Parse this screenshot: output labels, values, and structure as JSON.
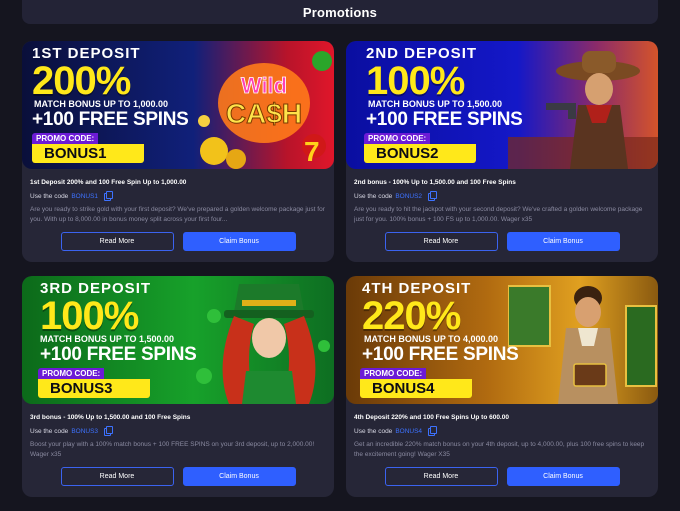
{
  "page": {
    "title": "Promotions"
  },
  "colors": {
    "accent_blue": "#2f5fff",
    "promo_yellow": "#ffe81a",
    "promo_purple": "#6c1bd6",
    "card_bg": "#262637",
    "page_bg": "#15151f"
  },
  "cards": [
    {
      "banner": {
        "title": "1ST DEPOSIT",
        "percent": "200%",
        "match": "MATCH BONUS UP TO 1,000.00",
        "spins": "+100 FREE SPINS",
        "promo_label": "PROMO CODE:",
        "promo_code": "BONUS1",
        "art": "wild-cash-slot-logo"
      },
      "headline": "1st Deposit 200% and 100 Free Spin Up to 1,000.00",
      "use_code_label": "Use the code",
      "code": "BONUS1",
      "description": "Are you ready to strike gold with your first deposit? We've prepared a golden welcome package just for you. With up to 8,000.00 in bonus money split across your first four...",
      "read_more": "Read More",
      "claim": "Claim Bonus"
    },
    {
      "banner": {
        "title": "2ND DEPOSIT",
        "percent": "100%",
        "match": "MATCH BONUS UP TO 1,500.00",
        "spins": "+100 FREE SPINS",
        "promo_label": "PROMO CODE:",
        "promo_code": "BONUS2",
        "art": "cowboy-gunslinger"
      },
      "headline": "2nd bonus - 100% Up to 1,500.00 and 100 Free Spins",
      "use_code_label": "Use the code",
      "code": "BONUS2",
      "description": "Are you ready to hit the jackpot with your second deposit? We've crafted a golden welcome package just for you. 100% bonus + 100 FS up to 1,000.00. Wager x35",
      "read_more": "Read More",
      "claim": "Claim Bonus"
    },
    {
      "banner": {
        "title": "3RD DEPOSIT",
        "percent": "100%",
        "match": "MATCH BONUS UP TO 1,500.00",
        "spins": "+100 FREE SPINS",
        "promo_label": "PROMO CODE:",
        "promo_code": "BONUS3",
        "art": "leprechaun-girl-clovers"
      },
      "headline": "3rd bonus - 100% Up to 1,500.00 and 100 Free Spins",
      "use_code_label": "Use the code",
      "code": "BONUS3",
      "description": "Boost your play with a 100% match bonus + 100 FREE SPINS on your 3rd deposit, up to 2,000.00! Wager x35",
      "read_more": "Read More",
      "claim": "Claim Bonus"
    },
    {
      "banner": {
        "title": "4TH DEPOSIT",
        "percent": "220%",
        "match": "MATCH BONUS UP TO 4,000.00",
        "spins": "+100 FREE SPINS",
        "promo_label": "PROMO CODE:",
        "promo_code": "BONUS4",
        "art": "explorer-book-slot"
      },
      "headline": "4th Deposit 220% and 100 Free Spins Up to 600.00",
      "use_code_label": "Use the code",
      "code": "BONUS4",
      "description": "Get an incredible 220% match bonus on your 4th deposit, up to 4,000.00, plus 100 free spins to keep the excitement going! Wager X35",
      "read_more": "Read More",
      "claim": "Claim Bonus"
    }
  ]
}
